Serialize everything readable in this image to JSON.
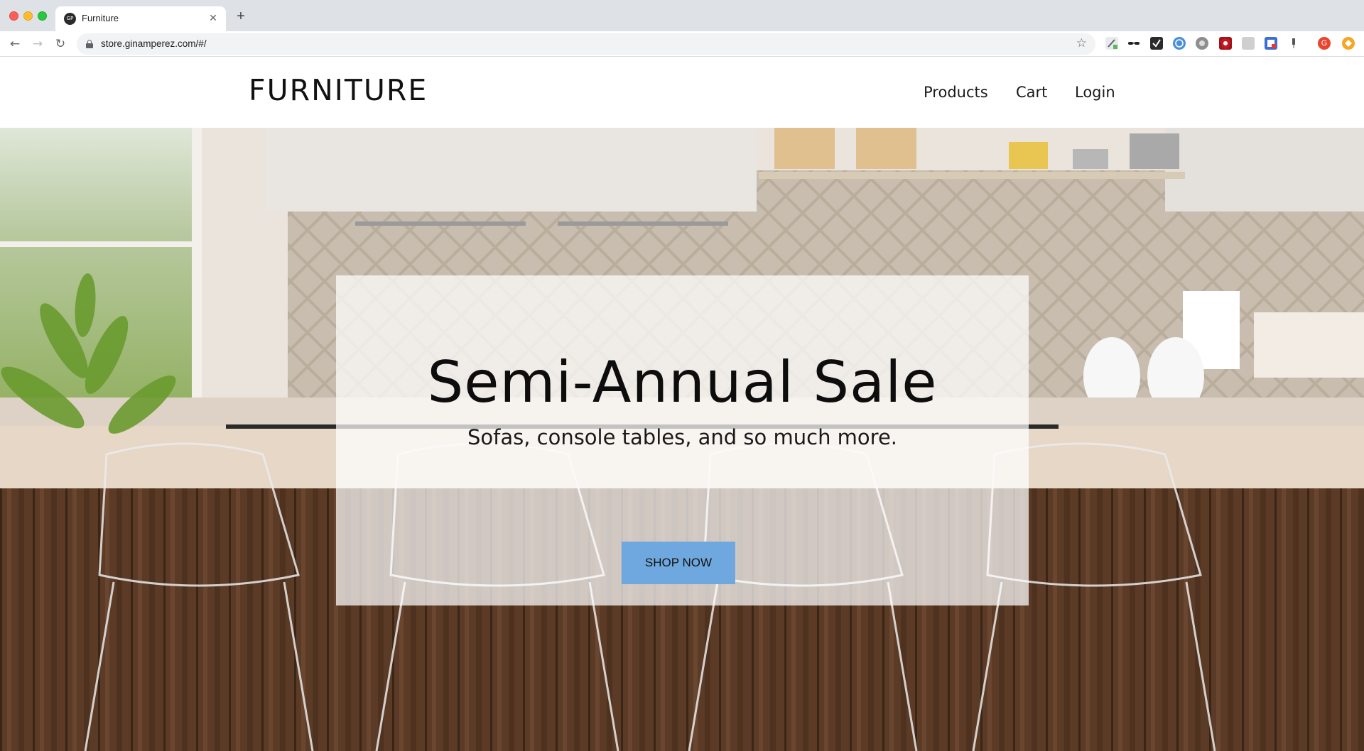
{
  "browser": {
    "tab": {
      "title": "Furniture",
      "favicon_text": "GP",
      "close_icon": "close-icon"
    },
    "new_tab_icon": "plus-icon",
    "back_icon": "arrow-left-icon",
    "forward_icon": "arrow-right-icon",
    "reload_icon": "reload-icon",
    "url": "store.ginamperez.com/#/",
    "bookmark_icon": "star-icon",
    "profile_initial": "G",
    "colors": {
      "tabstrip": "#dee1e6",
      "omnibox": "#f1f3f4"
    }
  },
  "site": {
    "logo": "FURNITURE",
    "nav": [
      "Products",
      "Cart",
      "Login"
    ]
  },
  "hero": {
    "title": "Semi-Annual Sale",
    "subtitle": "Sofas, console tables, and so much more.",
    "cta_label": "SHOP NOW",
    "colors": {
      "cta": "#6fa8de",
      "overlay": "rgba(255,255,255,0.72)"
    }
  }
}
